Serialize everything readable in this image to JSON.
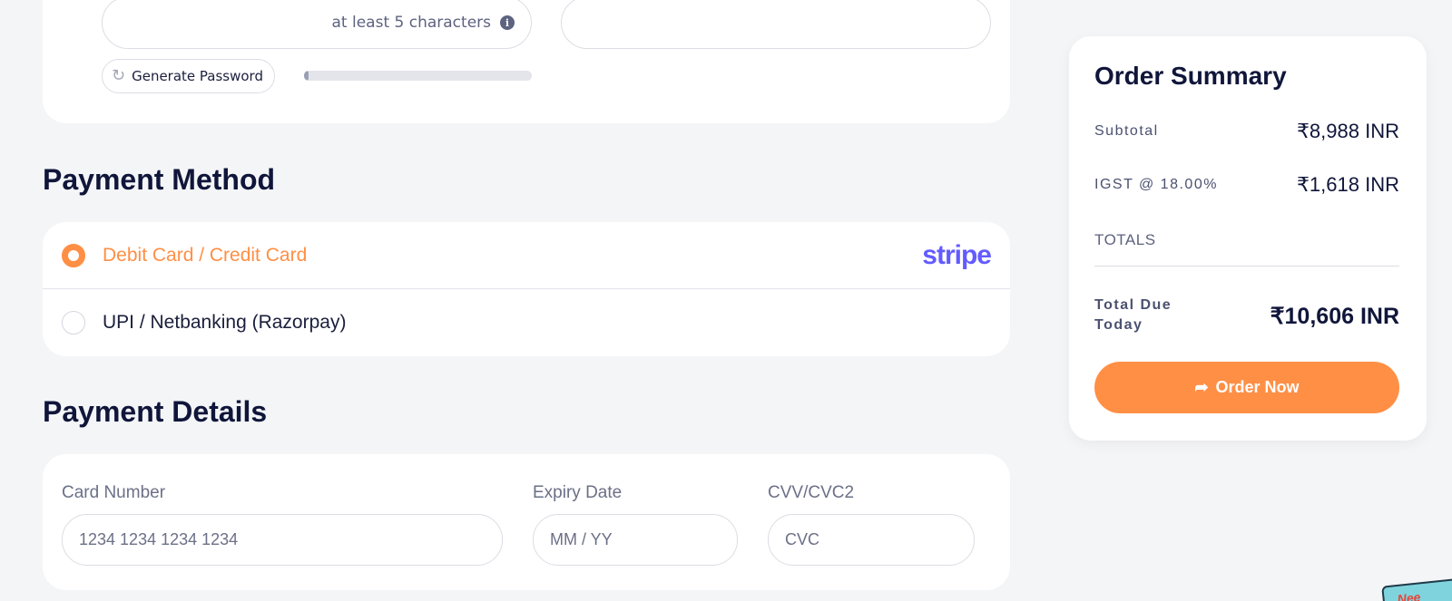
{
  "account": {
    "password_hint": "at least 5 characters",
    "generate_password_label": "Generate Password",
    "strength": 0.02
  },
  "payment_method": {
    "title": "Payment Method",
    "options": [
      {
        "label": "Debit Card / Credit Card",
        "provider": "stripe",
        "selected": true
      },
      {
        "label": "UPI / Netbanking (Razorpay)",
        "selected": false
      }
    ]
  },
  "payment_details": {
    "title": "Payment Details",
    "card_number_label": "Card Number",
    "card_number_placeholder": "1234 1234 1234 1234",
    "expiry_label": "Expiry Date",
    "expiry_placeholder": "MM / YY",
    "cvc_label": "CVV/CVC2",
    "cvc_placeholder": "CVC"
  },
  "summary": {
    "title": "Order Summary",
    "subtotal_label": "Subtotal",
    "subtotal_value": "₹8,988 INR",
    "tax_label": "IGST @ 18.00%",
    "tax_value": "₹1,618 INR",
    "totals_label": "TOTALS",
    "due_label": "Total Due Today",
    "due_value": "₹10,606 INR",
    "order_button": "Order Now"
  },
  "colors": {
    "accent": "#ff8f45",
    "stripe": "#635bff",
    "heading": "#10163a"
  }
}
